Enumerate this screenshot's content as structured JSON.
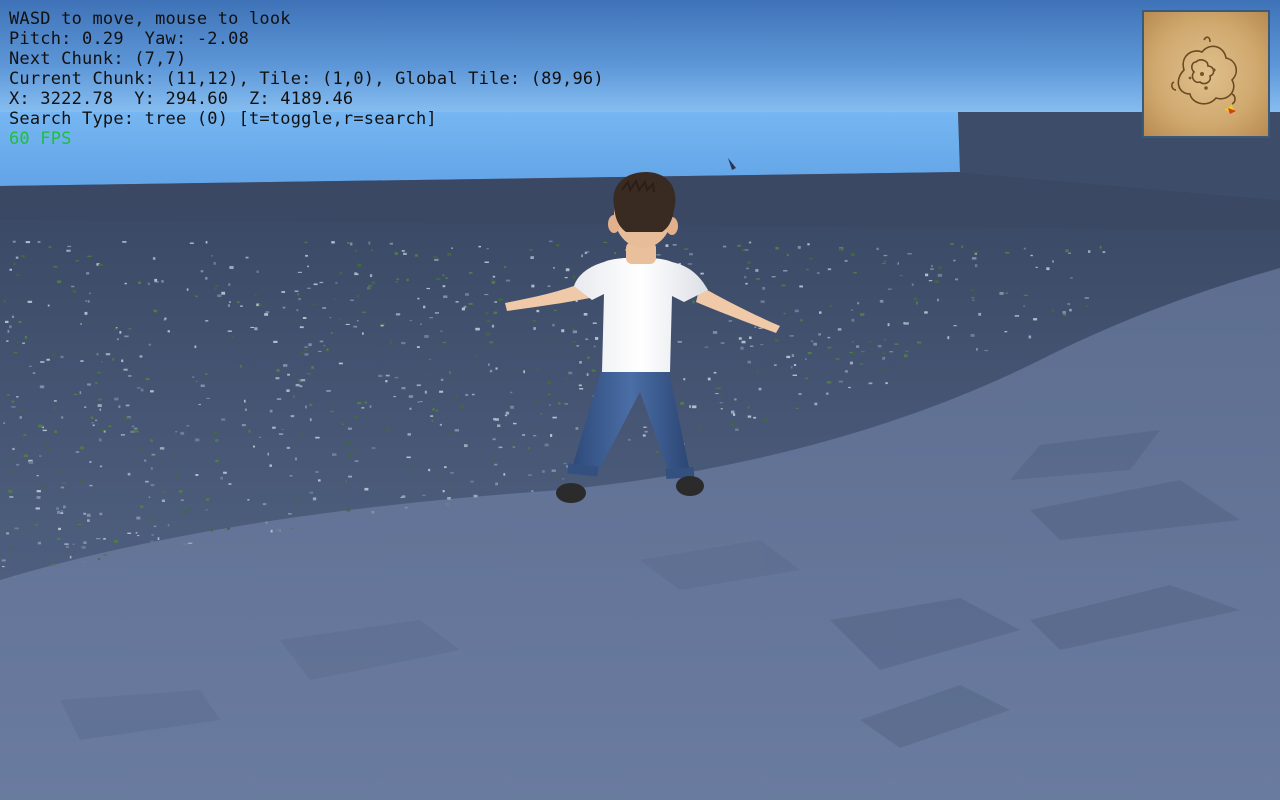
{
  "hud": {
    "lines": [
      "WASD to move, mouse to look",
      "Pitch: 0.29  Yaw: -2.08",
      "Next Chunk: (7,7)",
      "Current Chunk: (11,12), Tile: (1,0), Global Tile: (89,96)",
      "X: 3222.78  Y: 294.60  Z: 4189.46",
      "Search Type: tree (0) [t=toggle,r=search]"
    ],
    "fps": "60 FPS",
    "fps_color": "#1fbf3a",
    "text_color": "#111111"
  },
  "colors": {
    "sky_top": "#4b7ec4",
    "sky_bottom": "#7fb3ea",
    "ground": "#5a6a88",
    "minimap_parchment": "#d8b47a",
    "minimap_border": "#3a5a7a"
  },
  "icons": {
    "player": "player-character",
    "minimap_marker": "player-position-marker"
  }
}
